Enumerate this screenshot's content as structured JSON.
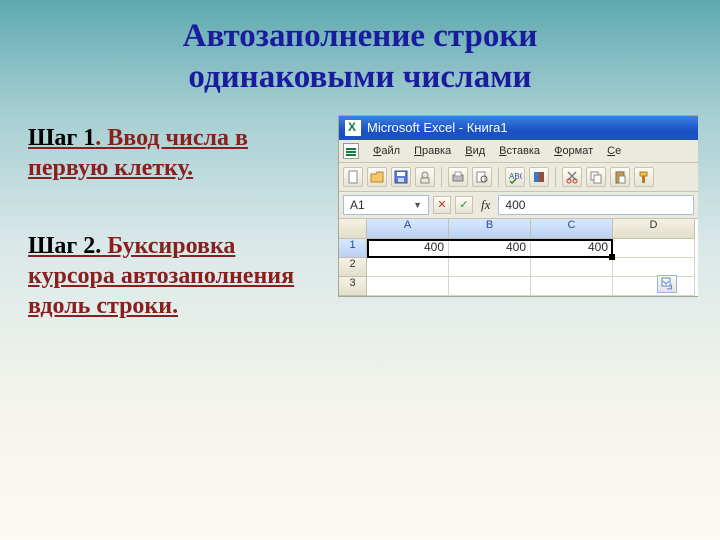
{
  "title_line1": "Автозаполнение строки",
  "title_line2": "одинаковыми числами",
  "step1": {
    "label": "Шаг 1",
    "text": "Ввод числа в первую клетку."
  },
  "step2": {
    "label": "Шаг 2.",
    "text": "Буксировка курсора автозаполнения вдоль строки."
  },
  "excel": {
    "app": "Microsoft Excel",
    "doc": "Книга1",
    "menu": [
      "Файл",
      "Правка",
      "Вид",
      "Вставка",
      "Формат",
      "Се"
    ],
    "namebox": "A1",
    "formula": "400",
    "columns": [
      "A",
      "B",
      "C",
      "D"
    ],
    "rows": [
      "1",
      "2",
      "3"
    ],
    "selected_columns": [
      "A",
      "B",
      "C"
    ],
    "selected_row": "1",
    "values": {
      "r1": [
        "400",
        "400",
        "400",
        ""
      ],
      "r2": [
        "",
        "",
        "",
        ""
      ],
      "r3": [
        "",
        "",
        "",
        ""
      ]
    }
  }
}
